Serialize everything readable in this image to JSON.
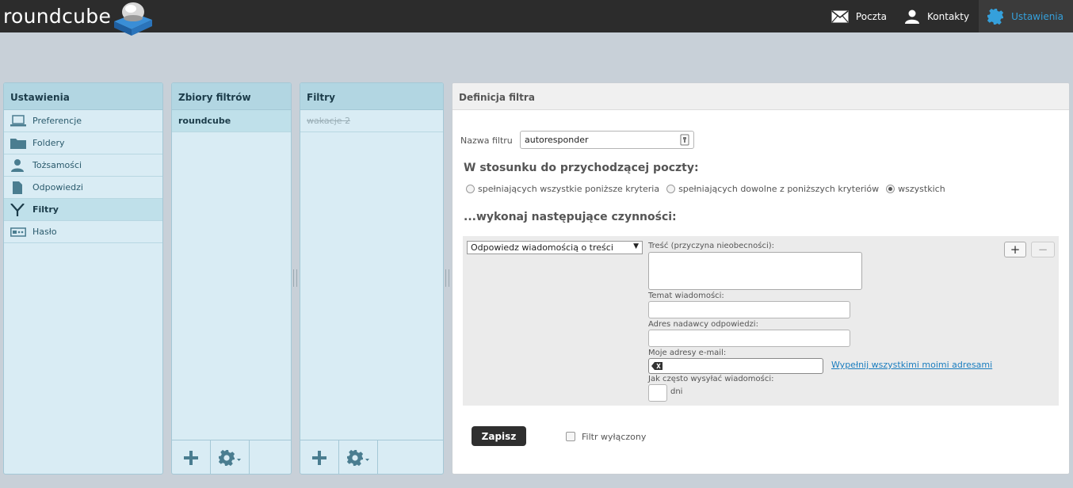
{
  "app": {
    "logo_text": "roundcube"
  },
  "topnav": {
    "mail": "Poczta",
    "contacts": "Kontakty",
    "settings": "Ustawienia"
  },
  "settings_panel": {
    "title": "Ustawienia",
    "items": [
      {
        "label": "Preferencje",
        "icon": "laptop-icon"
      },
      {
        "label": "Foldery",
        "icon": "folder-icon"
      },
      {
        "label": "Tożsamości",
        "icon": "identity-icon"
      },
      {
        "label": "Odpowiedzi",
        "icon": "document-icon"
      },
      {
        "label": "Filtry",
        "icon": "filter-icon"
      },
      {
        "label": "Hasło",
        "icon": "password-icon"
      }
    ]
  },
  "filtersets_panel": {
    "title": "Zbiory filtrów",
    "items": [
      "roundcube"
    ]
  },
  "filters_panel": {
    "title": "Filtry",
    "items": [
      "wakacje 2"
    ]
  },
  "definition": {
    "title": "Definicja filtra",
    "name_label": "Nazwa filtru",
    "name_value": "autoresponder",
    "incoming_heading": "W stosunku do przychodzącej poczty:",
    "match_all": "spełniających wszystkie poniższe kryteria",
    "match_any": "spełniających dowolne z poniższych kryteriów",
    "match_every": "wszystkich",
    "actions_heading": "...wykonaj następujące czynności:",
    "action_select": "Odpowiedz wiadomością o treści",
    "body_label": "Treść (przyczyna nieobecności):",
    "subject_label": "Temat wiadomości:",
    "from_label": "Adres nadawcy odpowiedzi:",
    "addresses_label": "Moje adresy e-mail:",
    "fill_link": "Wypełnij wszystkimi moimi adresami",
    "days_label": "Jak często wysyłać wiadomości:",
    "days_unit": "dni",
    "add_btn": "+",
    "remove_btn": "−",
    "save": "Zapisz",
    "disabled_label": "Filtr wyłączony"
  }
}
